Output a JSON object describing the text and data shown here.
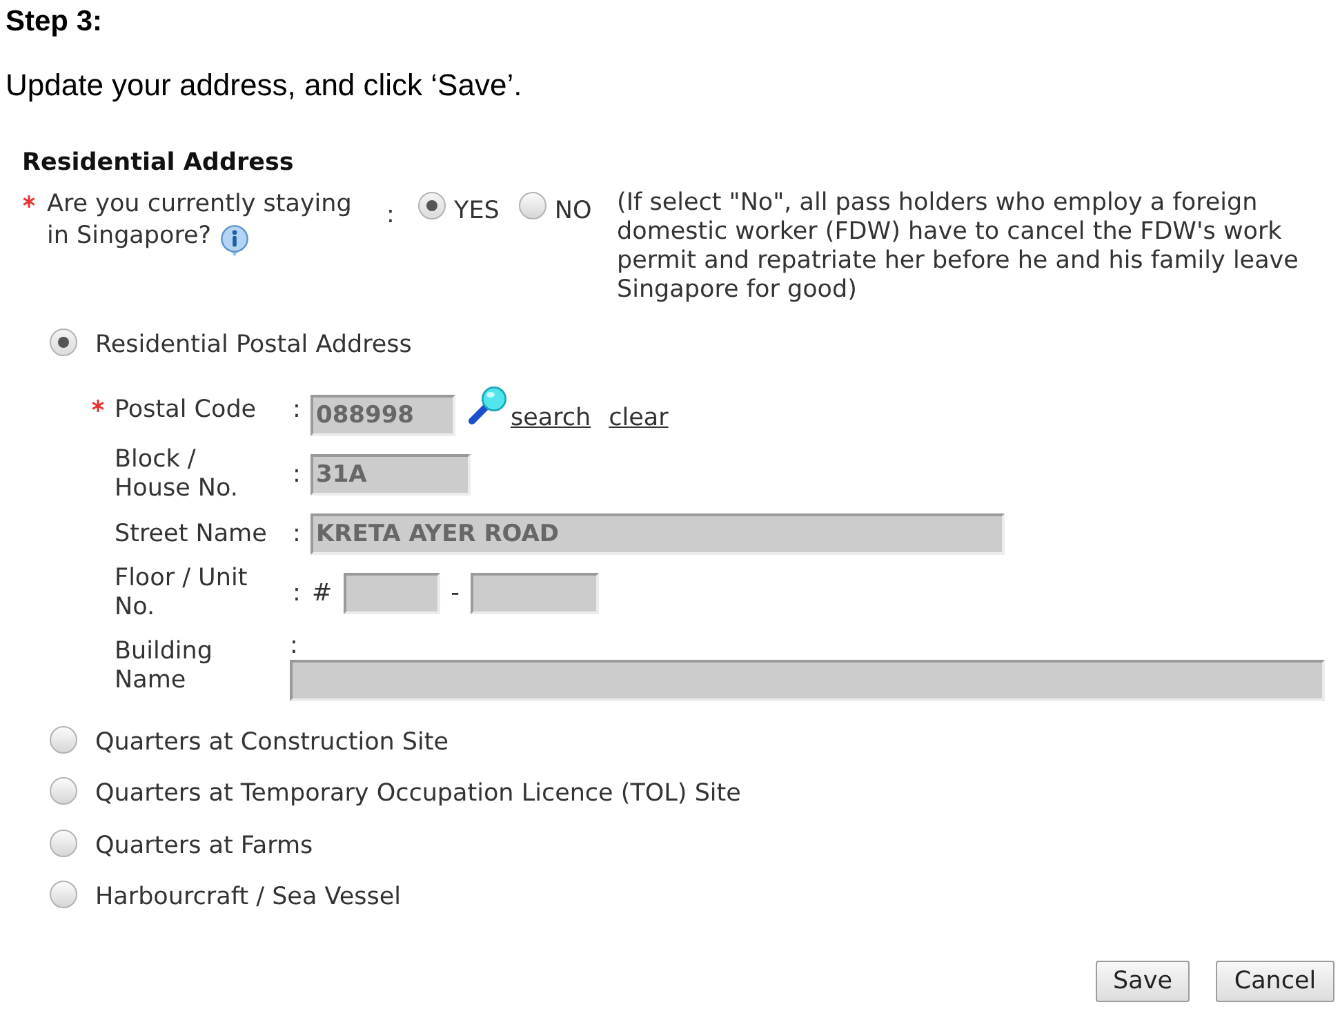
{
  "step_heading": "Step 3:",
  "instruction": "Update your address, and click ‘Save’.",
  "section": {
    "title": "Residential Address",
    "question": {
      "required": true,
      "label_lines": [
        "Are you currently staying",
        "in Singapore?"
      ],
      "colon": ":",
      "options": [
        {
          "label": "YES",
          "selected": true
        },
        {
          "label": "NO",
          "selected": false
        }
      ],
      "note": "(If select \"No\", all pass holders who employ a foreign domestic worker (FDW) have to cancel the FDW's work permit and repatriate her before he and his family leave Singapore for good)"
    },
    "address_types": [
      {
        "label": "Residential Postal Address",
        "selected": true,
        "fields": [
          {
            "kind": "postal",
            "label": "Postal Code",
            "required": true,
            "colon": ":",
            "value": "088998",
            "links": [
              "search",
              "clear"
            ]
          },
          {
            "kind": "block",
            "label": "Block / House No.",
            "required": false,
            "colon": ":",
            "value": "31A"
          },
          {
            "kind": "street",
            "label": "Street Name",
            "required": false,
            "colon": ":",
            "value": "KRETA AYER ROAD"
          },
          {
            "kind": "unit",
            "label": "Floor / Unit No.",
            "required": false,
            "colon": ":",
            "prefix": "#",
            "separator": "-"
          },
          {
            "kind": "building",
            "label": "Building Name",
            "required": false,
            "colon": ":"
          }
        ]
      },
      {
        "label": "Quarters at Construction Site",
        "selected": false
      },
      {
        "label": "Quarters at Temporary Occupation Licence (TOL) Site",
        "selected": false
      },
      {
        "label": "Quarters at Farms",
        "selected": false
      },
      {
        "label": "Harbourcraft / Sea Vessel",
        "selected": false
      }
    ]
  },
  "buttons": [
    {
      "label": "Save"
    },
    {
      "label": "Cancel"
    }
  ]
}
